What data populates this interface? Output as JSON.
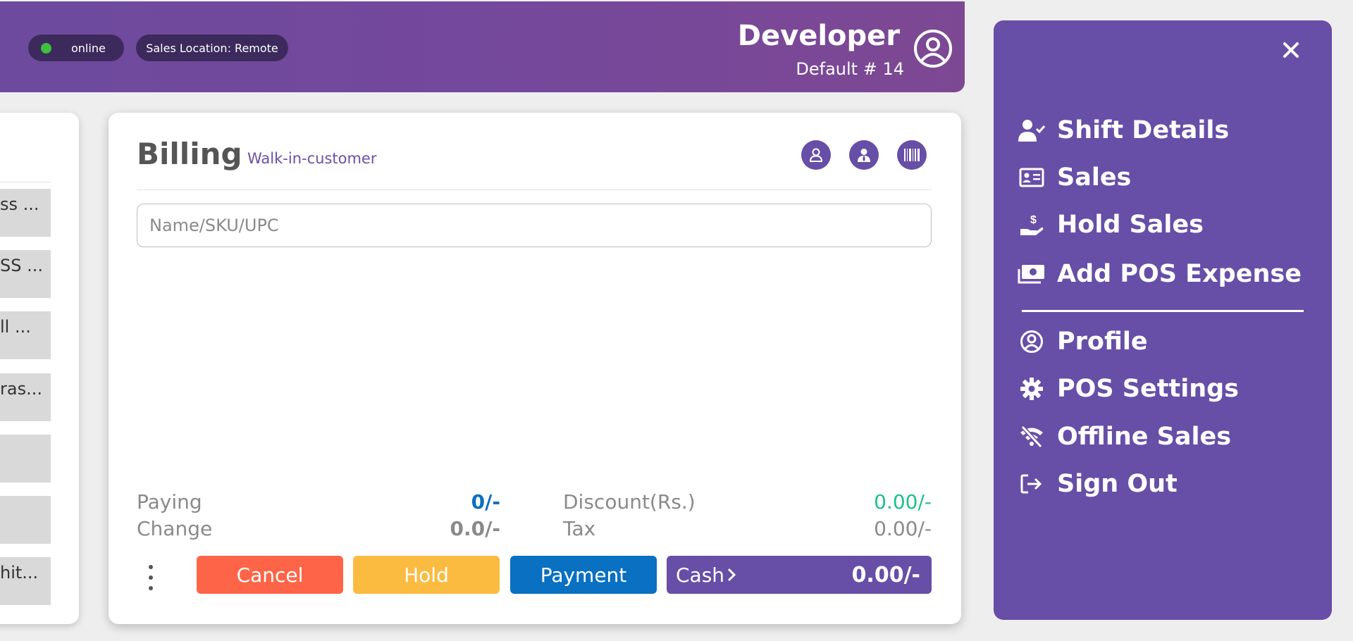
{
  "header": {
    "status_label": "online",
    "location_label": "Sales Location: Remote",
    "user_name": "Developer",
    "user_sub": "Default # 14"
  },
  "products": [
    "ss ...",
    "SS ...",
    "ll ...",
    "ras...",
    "",
    "",
    "hit..."
  ],
  "billing": {
    "title": "Billing",
    "customer": "Walk-in-customer",
    "search_placeholder": "Name/SKU/UPC",
    "summary": {
      "paying_label": "Paying",
      "paying_value": "0/-",
      "change_label": "Change",
      "change_value": "0.0/-",
      "discount_label": "Discount(Rs.)",
      "discount_value": "0.00/-",
      "tax_label": "Tax",
      "tax_value": "0.00/-"
    },
    "buttons": {
      "cancel": "Cancel",
      "hold": "Hold",
      "payment": "Payment",
      "cash_label": "Cash",
      "cash_amount": "0.00/-"
    }
  },
  "menu": {
    "items": [
      {
        "label": "Shift Details",
        "icon": "user-check-icon"
      },
      {
        "label": "Sales",
        "icon": "id-card-icon"
      },
      {
        "label": "Hold Sales",
        "icon": "hand-dollar-icon"
      },
      {
        "label": "Add POS Expense",
        "icon": "money-icon"
      },
      {
        "label": "Profile",
        "icon": "user-circle-icon"
      },
      {
        "label": "POS Settings",
        "icon": "gear-icon"
      },
      {
        "label": "Offline Sales",
        "icon": "wifi-off-icon"
      },
      {
        "label": "Sign Out",
        "icon": "sign-out-icon"
      }
    ]
  },
  "colors": {
    "purple": "#674ea7",
    "cancel": "#fe6447",
    "hold": "#fbbb41",
    "payment": "#0970c2",
    "paying_value": "#0b6fc2",
    "discount_value": "#1fc18a"
  }
}
